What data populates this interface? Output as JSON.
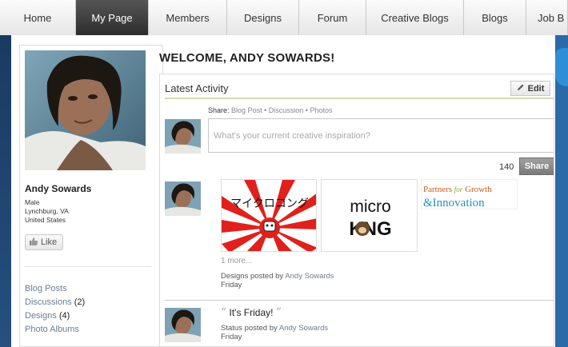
{
  "nav": {
    "tabs": [
      {
        "label": "Home",
        "active": false
      },
      {
        "label": "My Page",
        "active": true
      },
      {
        "label": "Members",
        "active": false
      },
      {
        "label": "Designs",
        "active": false
      },
      {
        "label": "Forum",
        "active": false
      },
      {
        "label": "Creative Blogs",
        "active": false
      },
      {
        "label": "Blogs",
        "active": false
      },
      {
        "label": "Job B",
        "active": false
      }
    ]
  },
  "profile": {
    "name": "Andy Sowards",
    "gender": "Male",
    "location": "Lynchburg, VA",
    "country": "United States",
    "like_label": "Like"
  },
  "sidebar": {
    "links": [
      {
        "label": "Blog Posts",
        "count": ""
      },
      {
        "label": "Discussions",
        "count": "(2)"
      },
      {
        "label": "Designs",
        "count": "(4)"
      },
      {
        "label": "Photo Albums",
        "count": ""
      }
    ]
  },
  "main": {
    "welcome": "WELCOME, ANDY SOWARDS!",
    "activity_title": "Latest Activity",
    "edit_label": "Edit",
    "share": {
      "label": "Share:",
      "options": [
        "Blog Post",
        "Discussion",
        "Photos"
      ],
      "separator": "•",
      "placeholder": "What's your current creative inspiration?",
      "char_count": "140",
      "button_label": "Share"
    },
    "designs": {
      "thumbs": [
        {
          "alt": "Rising sun design",
          "text": "マイクロコング"
        },
        {
          "alt": "Micro Kong logo",
          "text_top": "micro",
          "text_bottom": "KNG"
        },
        {
          "alt": "Partners for Growth & Innovation",
          "line1": "Partners",
          "line1_b": "for",
          "line1_c": "Growth",
          "line2": "&Innovation"
        }
      ],
      "more": "1 more...",
      "posted_prefix": "Designs posted by",
      "posted_by": "Andy Sowards",
      "day": "Friday"
    },
    "status": {
      "text": "It's Friday!",
      "posted_prefix": "Status posted by",
      "posted_by": "Andy Sowards",
      "day": "Friday"
    }
  },
  "colors": {
    "link": "#6d7d8d",
    "active_tab": "#3a3a3a",
    "share_button": "#8c8c8c",
    "background": "#1f3d66"
  }
}
